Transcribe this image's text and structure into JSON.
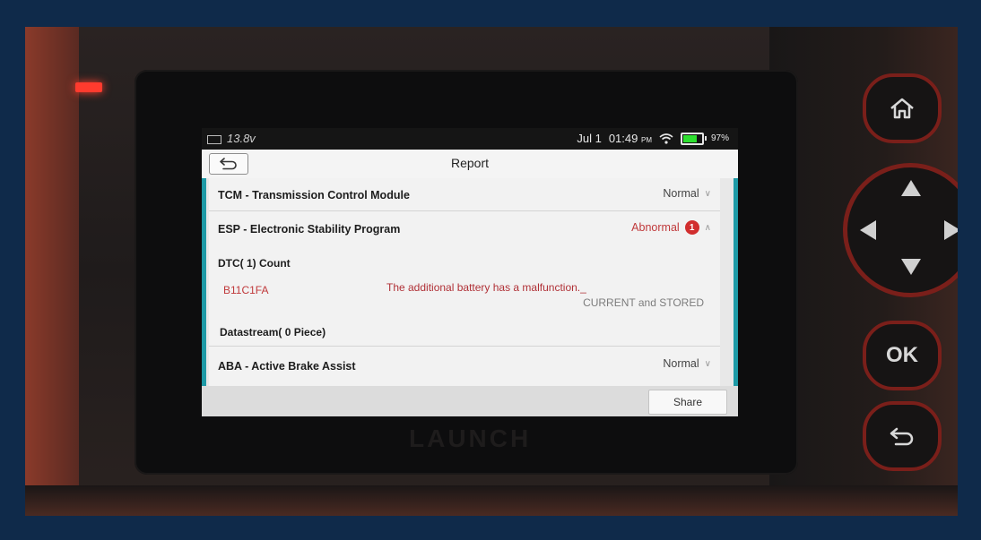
{
  "status_bar": {
    "voltage": "13.8v",
    "date": "Jul 1",
    "time": "01:49",
    "ampm": "PM",
    "battery_percent": "97%"
  },
  "header": {
    "title": "Report"
  },
  "modules": [
    {
      "title": "TCM - Transmission Control Module",
      "status": "Normal"
    },
    {
      "title": "ESP - Electronic Stability Program",
      "status": "Abnormal",
      "badge": "1"
    },
    {
      "title": "ABA - Active Brake Assist",
      "status": "Normal"
    }
  ],
  "esp_details": {
    "dtc_count_label": "DTC( 1) Count",
    "dtc_code": "B11C1FA",
    "dtc_description": "The additional battery has a malfunction._",
    "dtc_state": "CURRENT and STORED",
    "datastream_label": "Datastream( 0 Piece)"
  },
  "footer": {
    "share_label": "Share"
  },
  "device": {
    "brand": "LAUNCH",
    "ok_label": "OK"
  },
  "colors": {
    "accent_teal": "#1e9aa6",
    "abnormal_red": "#c0393b",
    "device_red": "#7a1f1a"
  }
}
